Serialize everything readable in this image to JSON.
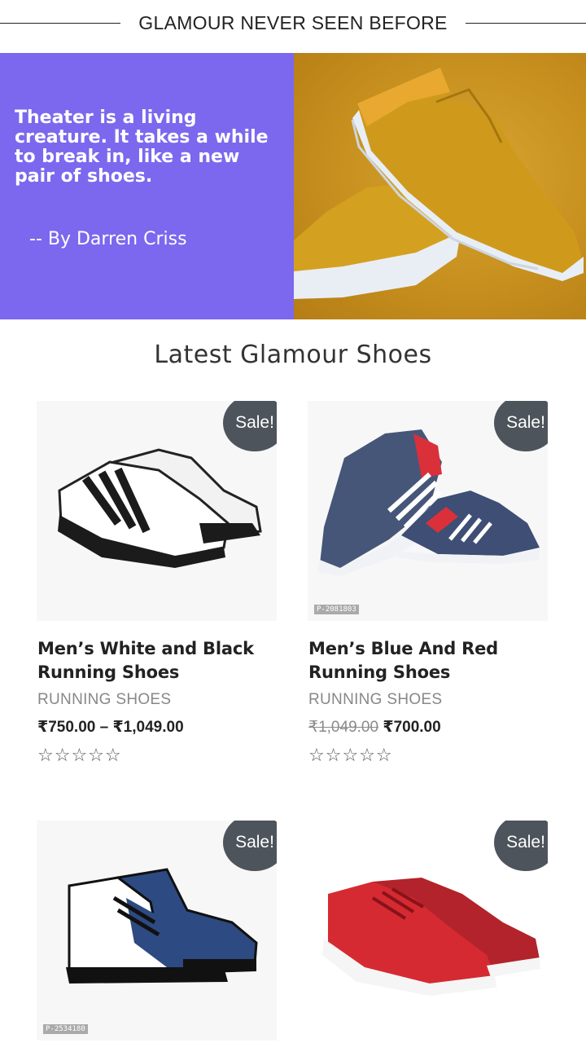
{
  "header": {
    "title": "GLAMOUR NEVER SEEN BEFORE"
  },
  "banner": {
    "quote": "Theater is a living creature. It takes a while to break in, like a new pair of shoes.",
    "author": "-- By Darren Criss",
    "colors": {
      "quote_bg": "#7b68ee",
      "image_bg": "#c68f1e"
    }
  },
  "section": {
    "title": "Latest Glamour Shoes"
  },
  "products": [
    {
      "sale_badge": "Sale!",
      "name": "Men’s White and Black Running Shoes",
      "category": "RUNNING SHOES",
      "price": "₹750.00 – ₹1,049.00",
      "old_price": "",
      "stars": "☆☆☆☆☆",
      "code": ""
    },
    {
      "sale_badge": "Sale!",
      "name": "Men’s Blue And Red Running Shoes",
      "category": "RUNNING SHOES",
      "price": "₹700.00",
      "old_price": "₹1,049.00",
      "stars": "☆☆☆☆☆",
      "code": "P-2081803"
    },
    {
      "sale_badge": "Sale!",
      "name": "",
      "category": "",
      "price": "",
      "old_price": "",
      "stars": "",
      "code": "P-2534180"
    },
    {
      "sale_badge": "Sale!",
      "name": "",
      "category": "",
      "price": "",
      "old_price": "",
      "stars": "",
      "code": ""
    }
  ]
}
